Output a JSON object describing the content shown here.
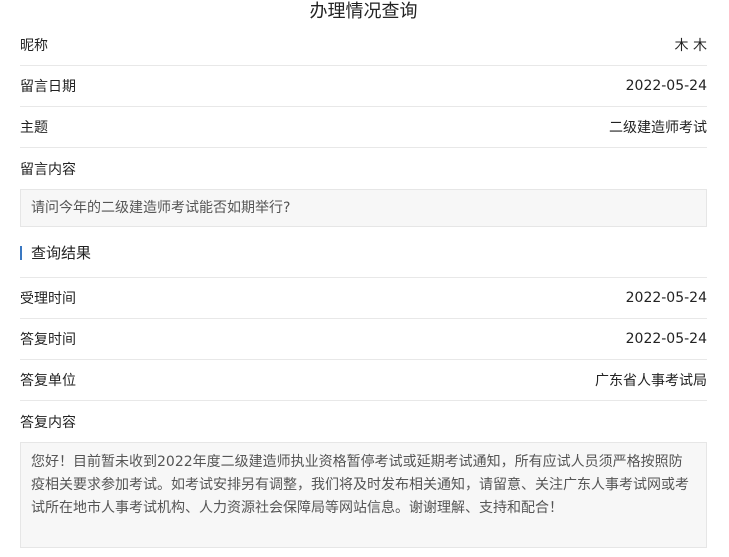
{
  "page": {
    "title": "办理情况查询"
  },
  "message": {
    "nickname_label": "昵称",
    "nickname_value": "木 木",
    "date_label": "留言日期",
    "date_value": "2022-05-24",
    "subject_label": "主题",
    "subject_value": "二级建造师考试",
    "content_label": "留言内容",
    "content_value": "请问今年的二级建造师考试能否如期举行?"
  },
  "result": {
    "section_title": "查询结果",
    "accept_time_label": "受理时间",
    "accept_time_value": "2022-05-24",
    "reply_time_label": "答复时间",
    "reply_time_value": "2022-05-24",
    "reply_unit_label": "答复单位",
    "reply_unit_value": "广东省人事考试局",
    "reply_content_label": "答复内容",
    "reply_content_value": "您好！目前暂未收到2022年度二级建造师执业资格暂停考试或延期考试通知，所有应试人员须严格按照防疫相关要求参加考试。如考试安排另有调整，我们将及时发布相关通知，请留意、关注广东人事考试网或考试所在地市人事考试机构、人力资源社会保障局等网站信息。谢谢理解、支持和配合！"
  },
  "colors": {
    "accent": "#3a78c2",
    "border": "#e8e8e8",
    "box_background": "#f7f7f7"
  }
}
